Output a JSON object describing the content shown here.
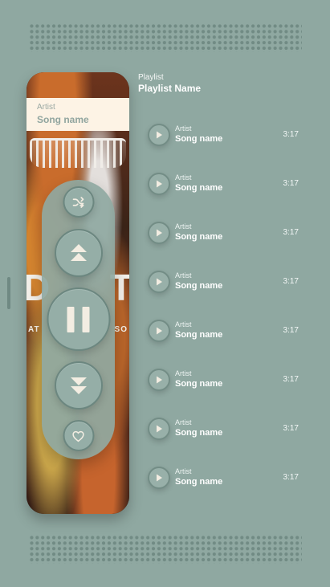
{
  "now_playing": {
    "artist": "Artist",
    "song": "Song name"
  },
  "playlist": {
    "label": "Playlist",
    "name": "Playlist Name"
  },
  "tracks": [
    {
      "artist": "Artist",
      "song": "Song name",
      "duration": "3:17"
    },
    {
      "artist": "Artist",
      "song": "Song name",
      "duration": "3:17"
    },
    {
      "artist": "Artist",
      "song": "Song name",
      "duration": "3:17"
    },
    {
      "artist": "Artist",
      "song": "Song name",
      "duration": "3:17"
    },
    {
      "artist": "Artist",
      "song": "Song name",
      "duration": "3:17"
    },
    {
      "artist": "Artist",
      "song": "Song name",
      "duration": "3:17"
    },
    {
      "artist": "Artist",
      "song": "Song name",
      "duration": "3:17"
    },
    {
      "artist": "Artist",
      "song": "Song name",
      "duration": "3:17"
    }
  ],
  "album_art_text": {
    "big_left": "D",
    "big_right": "T",
    "small_left": "AT",
    "small_right": "SO"
  },
  "icons": {
    "shuffle": "shuffle-icon",
    "previous": "double-up-arrow-icon",
    "pause": "pause-icon",
    "next": "double-down-arrow-icon",
    "like": "heart-icon",
    "track_play": "play-icon"
  },
  "colors": {
    "background": "#8fa8a1",
    "accent": "#ffffff",
    "now_playing_bg": "#fdf3e5",
    "control_stroke": "#6c8780",
    "icon": "#f3ede2"
  }
}
